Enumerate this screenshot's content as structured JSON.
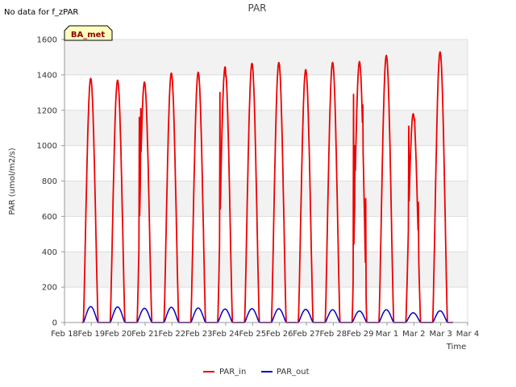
{
  "note": "No data for f_zPAR",
  "badge": "BA_met",
  "colors": {
    "PAR_in": "#ee0000",
    "PAR_out": "#0000cc",
    "band": "#f2f2f2",
    "grid": "#dddddd",
    "badge_fill": "#ffffc0"
  },
  "chart_data": {
    "type": "line",
    "title": "PAR",
    "xlabel": "Time",
    "ylabel": "PAR (umol/m2/s)",
    "ylim": [
      0,
      1600
    ],
    "yticks": [
      0,
      200,
      400,
      600,
      800,
      1000,
      1200,
      1400,
      1600
    ],
    "xlim": [
      "2024-02-18",
      "2024-03-04"
    ],
    "xtick_labels": [
      "Feb 18",
      "Feb 19",
      "Feb 20",
      "Feb 21",
      "Feb 22",
      "Feb 23",
      "Feb 24",
      "Feb 25",
      "Feb 26",
      "Feb 27",
      "Feb 28",
      "Feb 29",
      "Mar 1",
      "Mar 2",
      "Mar 3",
      "Mar 4"
    ],
    "grid": true,
    "legend_position": "bottom-center",
    "series": [
      {
        "name": "PAR_in",
        "daily_peaks": [
          {
            "date": "Feb 19",
            "peak": 1380
          },
          {
            "date": "Feb 20",
            "peak": 1370
          },
          {
            "date": "Feb 21",
            "peak": 1360
          },
          {
            "date": "Feb 22",
            "peak": 1410
          },
          {
            "date": "Feb 23",
            "peak": 1415
          },
          {
            "date": "Feb 24",
            "peak": 1445
          },
          {
            "date": "Feb 25",
            "peak": 1465
          },
          {
            "date": "Feb 26",
            "peak": 1470
          },
          {
            "date": "Feb 27",
            "peak": 1430
          },
          {
            "date": "Feb 28",
            "peak": 1470
          },
          {
            "date": "Feb 29",
            "peak": 1475
          },
          {
            "date": "Mar 1",
            "peak": 1510
          },
          {
            "date": "Mar 2",
            "peak": 1180
          },
          {
            "date": "Mar 3",
            "peak": 1530
          }
        ]
      },
      {
        "name": "PAR_out",
        "daily_peaks": [
          {
            "date": "Feb 19",
            "peak": 90
          },
          {
            "date": "Feb 20",
            "peak": 88
          },
          {
            "date": "Feb 21",
            "peak": 80
          },
          {
            "date": "Feb 22",
            "peak": 86
          },
          {
            "date": "Feb 23",
            "peak": 82
          },
          {
            "date": "Feb 24",
            "peak": 76
          },
          {
            "date": "Feb 25",
            "peak": 78
          },
          {
            "date": "Feb 26",
            "peak": 78
          },
          {
            "date": "Feb 27",
            "peak": 74
          },
          {
            "date": "Feb 28",
            "peak": 72
          },
          {
            "date": "Feb 29",
            "peak": 65
          },
          {
            "date": "Mar 1",
            "peak": 72
          },
          {
            "date": "Mar 2",
            "peak": 55
          },
          {
            "date": "Mar 3",
            "peak": 66
          }
        ]
      }
    ]
  }
}
